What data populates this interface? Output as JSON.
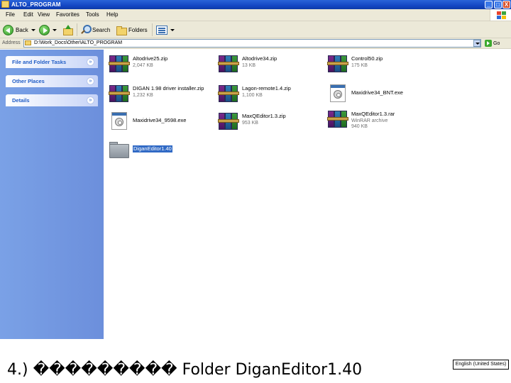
{
  "window": {
    "title": "ALTO_PROGRAM",
    "caption_buttons": {
      "minimize": "_",
      "maximize": "□",
      "close": "X"
    }
  },
  "menu": [
    "File",
    "Edit",
    "View",
    "Favorites",
    "Tools",
    "Help"
  ],
  "toolbar": {
    "back": "Back",
    "search": "Search",
    "folders": "Folders"
  },
  "address": {
    "label": "Address",
    "value": "D:\\Work_Docs\\Other\\ALTO_PROGRAM",
    "go": "Go"
  },
  "taskpane": {
    "panels": [
      "File and Folder Tasks",
      "Other Places",
      "Details"
    ]
  },
  "files": [
    {
      "name": "Altodrive25.zip",
      "sub": "2,047 KB",
      "sub2": "",
      "icon": "rar-archive-icon"
    },
    {
      "name": "Altodrive34.zip",
      "sub": "13 KB",
      "sub2": "",
      "icon": "rar-archive-icon"
    },
    {
      "name": "Control50.zip",
      "sub": "175 KB",
      "sub2": "",
      "icon": "rar-archive-icon"
    },
    {
      "name": "DIGAN 1.98 driver installer.zip",
      "sub": "1,232 KB",
      "sub2": "",
      "icon": "rar-archive-icon"
    },
    {
      "name": "Lagon-remote1.4.zip",
      "sub": "1,100 KB",
      "sub2": "",
      "icon": "rar-archive-icon"
    },
    {
      "name": "Maxidrive34_BNT.exe",
      "sub": "",
      "sub2": "",
      "icon": "installer-exe-icon"
    },
    {
      "name": "Maxidrive34_9598.exe",
      "sub": "",
      "sub2": "",
      "icon": "installer-exe-icon"
    },
    {
      "name": "MaxQEditor1.3.zip",
      "sub": "953 KB",
      "sub2": "",
      "icon": "rar-archive-icon"
    },
    {
      "name": "MaxQEditor1.3.rar",
      "sub": "WinRAR archive",
      "sub2": "940 KB",
      "icon": "rar-archive-icon"
    },
    {
      "name": "DiganEditor1.40",
      "sub": "",
      "sub2": "",
      "icon": "folder-icon",
      "selected": true
    }
  ],
  "caption": "4.) ��������� Folder DiganEditor1.40",
  "language_indicator": "English (United States)"
}
